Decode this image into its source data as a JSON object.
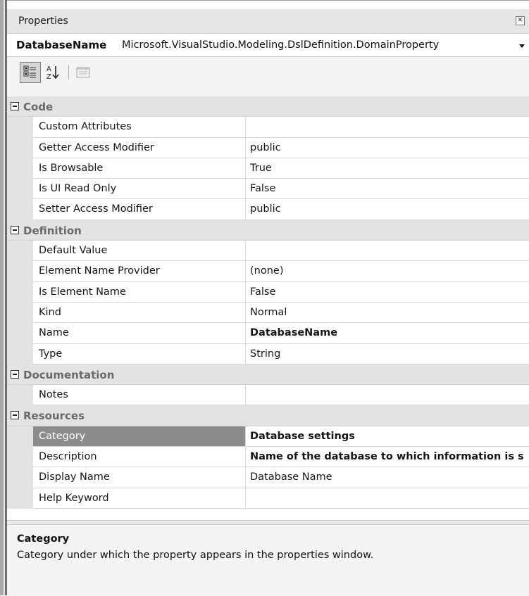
{
  "window": {
    "title": "Properties"
  },
  "object_selector": {
    "name": "DatabaseName",
    "type": "Microsoft.VisualStudio.Modeling.DslDefinition.DomainProperty"
  },
  "toolbar": {
    "buttons": [
      "categorized-icon",
      "alphabetical-icon",
      "property-pages-icon"
    ]
  },
  "categories": [
    {
      "label": "Code",
      "properties": [
        {
          "name": "Custom Attributes",
          "value": ""
        },
        {
          "name": "Getter Access Modifier",
          "value": "public"
        },
        {
          "name": "Is Browsable",
          "value": "True"
        },
        {
          "name": "Is UI Read Only",
          "value": "False"
        },
        {
          "name": "Setter Access Modifier",
          "value": "public"
        }
      ]
    },
    {
      "label": "Definition",
      "properties": [
        {
          "name": "Default Value",
          "value": ""
        },
        {
          "name": "Element Name Provider",
          "value": "(none)"
        },
        {
          "name": "Is Element Name",
          "value": "False"
        },
        {
          "name": "Kind",
          "value": "Normal"
        },
        {
          "name": "Name",
          "value": "DatabaseName"
        },
        {
          "name": "Type",
          "value": "String"
        }
      ]
    },
    {
      "label": "Documentation",
      "properties": [
        {
          "name": "Notes",
          "value": ""
        }
      ]
    },
    {
      "label": "Resources",
      "properties": [
        {
          "name": "Category",
          "value": "Database settings"
        },
        {
          "name": "Description",
          "value": "Name of the database to which information is s"
        },
        {
          "name": "Display Name",
          "value": "Database Name"
        },
        {
          "name": "Help Keyword",
          "value": ""
        }
      ]
    }
  ],
  "selected_property": "Category",
  "description": {
    "title": "Category",
    "text": "Category under which the property appears in the properties window."
  },
  "colors": {
    "category_background": "#e3e3e3",
    "selected_row": "#8c8c8c",
    "toolbar_background": "#f4f4f4"
  }
}
